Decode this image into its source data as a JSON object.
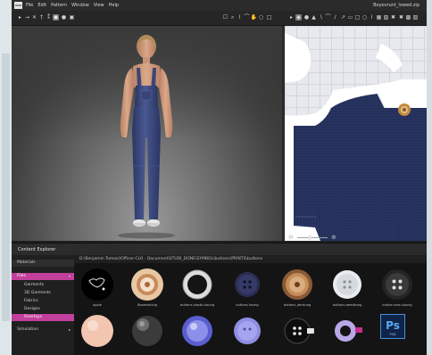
{
  "window": {
    "logo": "CLO",
    "menus": [
      "File",
      "Edit",
      "Pattern",
      "Window",
      "View",
      "Help"
    ],
    "file_name": "Boyovrunt_lowed.zip"
  },
  "explorer": {
    "title": "Content Explorer",
    "path": "D:\\Benjamin Tomasi\\Officer-CLO - Document\\STUDI_DONE\\SYMBOL\\buttons\\PRINTS\\buttons"
  },
  "library_tree": {
    "header": "Materials",
    "category": "Files",
    "items": [
      "Garments",
      "3D Garments",
      "Fabrics",
      "Designs",
      "Overlays"
    ],
    "selected": "Overlays",
    "simulation": "Simulation"
  },
  "thumbnails": [
    {
      "icon": "black-button-icon",
      "caption": "apple"
    },
    {
      "icon": "metal-rivet-button-icon",
      "caption": "Boombshing"
    },
    {
      "icon": "silver-ring-button-icon",
      "caption": "buttons plastic-koung"
    },
    {
      "icon": "navy-button-icon",
      "caption": "buttons koung"
    },
    {
      "icon": "copper-button-icon",
      "caption": "buttons_denkung"
    },
    {
      "icon": "white-button-icon",
      "caption": "buttons-weedkung"
    },
    {
      "icon": "dark-button-icon",
      "caption": "button oven-koung"
    },
    {
      "icon": "peach-swatch-icon",
      "caption": ""
    },
    {
      "icon": "dark-sphere-icon",
      "caption": ""
    },
    {
      "icon": "blue-sphere-icon",
      "caption": ""
    },
    {
      "icon": "lilac-button-icon",
      "caption": ""
    },
    {
      "icon": "black-white-button-icon",
      "caption": ""
    },
    {
      "icon": "lilac-ring-button-icon",
      "caption": ""
    },
    {
      "icon": "photoshop-file-icon",
      "caption": ""
    }
  ],
  "ps_file": {
    "letters": "Ps",
    "ext": "PSD"
  },
  "colors": {
    "accent": "#c33f9c",
    "denim": "#3d4a7a",
    "panel": "#1e1e1e"
  }
}
